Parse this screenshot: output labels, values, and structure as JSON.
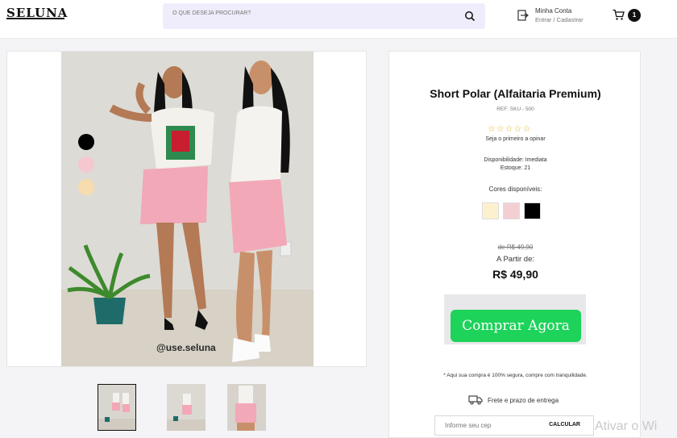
{
  "header": {
    "logo_text": "SELUNA",
    "search_placeholder": "O QUE DESEJA PROCURAR?",
    "account_title": "Minha Conta",
    "account_sub": "Entrar / Cadastrar",
    "cart_count": "1"
  },
  "gallery": {
    "watermark": "@use.seluna",
    "color_dots": [
      "#000000",
      "#f5c8cf",
      "#f7dcae"
    ]
  },
  "product": {
    "title": "Short Polar (Alfaitaria Premium)",
    "ref": "REF:  SKU - 500",
    "stars": "☆☆☆☆☆",
    "review_prompt": "Seja o primeiro a opinar",
    "availability": "Disponibilidade: Imediata",
    "stock": "Estoque: 21",
    "colors_label": "Cores disponíveis:",
    "swatches": [
      "#fdf0cf",
      "#f3cfd3",
      "#000000"
    ],
    "old_price": "de R$ 49,90",
    "from_label": "A Partir de:",
    "price": "R$ 49,90",
    "buy_label": "Comprar Agora",
    "secure_note": "* Aqui sua compra é 100% segura, compre com tranquilidade.",
    "shipping_label": "Frete e prazo de entrega",
    "cep_placeholder": "Informe seu cep",
    "cep_button": "CALCULAR"
  },
  "os_overlay": "Ativar o Wi"
}
